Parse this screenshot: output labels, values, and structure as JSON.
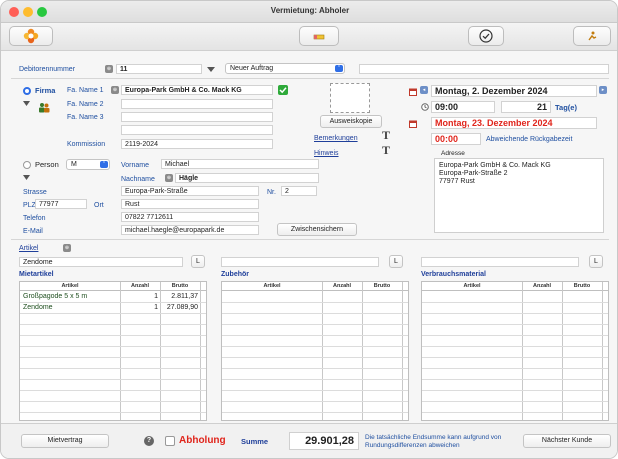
{
  "window": {
    "title": "Vermietung: Abholer"
  },
  "top": {
    "debitor_label": "Debitorennummer",
    "debitor_value": "11",
    "auftrag_select": "Neuer Auftrag"
  },
  "firma": {
    "radio_label": "Firma",
    "name1_label": "Fa. Name 1",
    "name1_value": "Europa-Park GmbH & Co. Mack KG",
    "name2_label": "Fa. Name 2",
    "name3_label": "Fa. Name 3",
    "kommission_label": "Kommission",
    "kommission_value": "2119-2024",
    "ausweiskopie_button": "Ausweiskopie",
    "bemerkungen_link": "Bemerkungen",
    "hinweis_link": "Hinweis"
  },
  "person": {
    "radio_label": "Person",
    "anrede_value": "M",
    "vorname_label": "Vorname",
    "vorname_value": "Michael",
    "nachname_label": "Nachname",
    "nachname_value": "Hägle"
  },
  "address": {
    "strasse_label": "Strasse",
    "strasse_value": "Europa-Park-Straße",
    "nr_label": "Nr.",
    "nr_value": "2",
    "plz_label": "PLZ",
    "plz_value": "77977",
    "ort_label": "Ort",
    "ort_value": "Rust",
    "telefon_label": "Telefon",
    "telefon_value": "07822 7712611",
    "email_label": "E-Mail",
    "email_value": "michael.haegle@europapark.de",
    "zwischensichern_button": "Zwischensichern"
  },
  "dates": {
    "start_date": "Montag, 2. Dezember 2024",
    "start_time": "09:00",
    "days_value": "21",
    "days_unit": "Tag(e)",
    "end_date": "Montag, 23. Dezember 2024",
    "end_time": "00:00",
    "return_label": "Abweichende Rückgabezeit",
    "adresse_label": "Adresse",
    "adresse_lines": [
      "Europa-Park GmbH & Co. Mack KG",
      "Europa-Park-Straße  2",
      "77977 Rust"
    ]
  },
  "artikel": {
    "link": "Artikel",
    "search_value": "Zendome",
    "l_button": "L"
  },
  "tables": {
    "miet_title": "Mietartikel",
    "zub_title": "Zubehör",
    "verb_title": "Verbrauchsmaterial",
    "col_artikel": "Artikel",
    "col_anzahl": "Anzahl",
    "col_brutto": "Brutto",
    "miet_rows": [
      {
        "artikel": "Großpagode 5 x 5 m",
        "anzahl": "1",
        "brutto": "2.811,37"
      },
      {
        "artikel": "Zendome",
        "anzahl": "1",
        "brutto": "27.089,90"
      }
    ]
  },
  "footer": {
    "mietvertrag_button": "Mietvertrag",
    "abholung_label": "Abholung",
    "summe_label": "Summe",
    "summe_value": "29.901,28",
    "note": "Die tatsächliche Endsumme kann aufgrund von Rundungsdifferenzen abweichen",
    "naechster_button": "Nächster Kunde"
  },
  "colors": {
    "accent": "#1f3f9a",
    "red": "#e0241b",
    "select_blue": "#2f6ee6"
  }
}
